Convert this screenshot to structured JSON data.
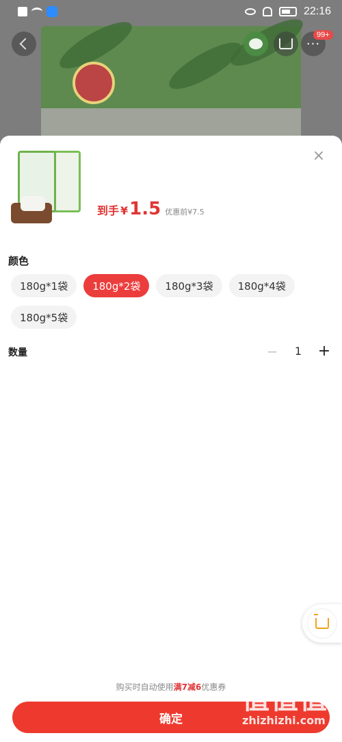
{
  "status_bar": {
    "time": "22:16"
  },
  "top_bar": {
    "badge_count": "99+"
  },
  "sheet": {
    "close_symbol": "×",
    "price": {
      "prefix": "到手",
      "currency": "¥",
      "value": "1.5",
      "original": "优惠前¥7.5"
    },
    "color_section": {
      "label": "颜色",
      "options": [
        {
          "label": "180g*1袋",
          "selected": false
        },
        {
          "label": "180g*2袋",
          "selected": true
        },
        {
          "label": "180g*3袋",
          "selected": false
        },
        {
          "label": "180g*4袋",
          "selected": false
        },
        {
          "label": "180g*5袋",
          "selected": false
        }
      ]
    },
    "quantity": {
      "label": "数量",
      "minus": "−",
      "value": "1",
      "plus": "+"
    },
    "coupon_note": {
      "prefix": "购买时自动使用",
      "highlight": "满7减6",
      "suffix": "优惠券"
    },
    "confirm_label": "确定"
  },
  "watermark": {
    "logo": "值值值",
    "text": "zhizhizhi.com"
  },
  "colors": {
    "accent": "#ec3d3d",
    "confirm_button": "#ee3a2e",
    "cart_icon": "#f3a31a"
  },
  "icons": [
    "back-icon",
    "wechat-icon",
    "cart-icon",
    "more-icon",
    "close-icon",
    "minus-icon",
    "plus-icon",
    "floating-cart-icon"
  ]
}
